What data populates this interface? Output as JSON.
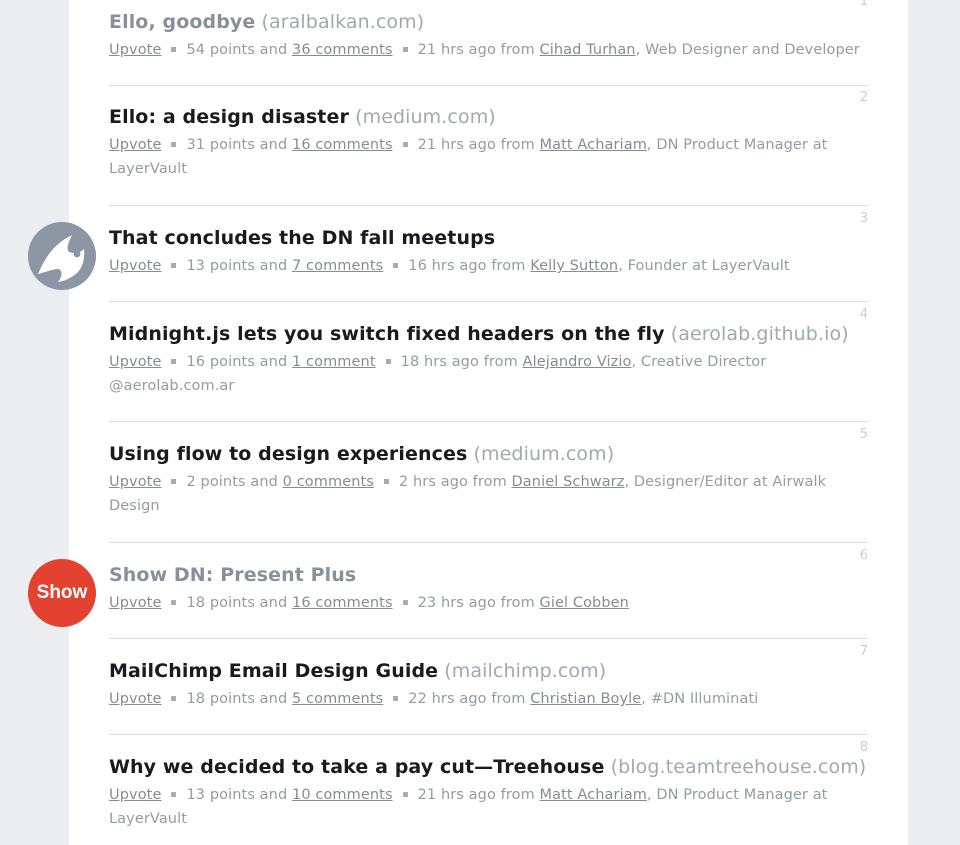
{
  "stories": [
    {
      "rank": "1",
      "title": "Ello, goodbye",
      "domain": "(aralbalkan.com)",
      "title_muted": true,
      "upvote": "Upvote",
      "points": "54 points and",
      "comments": "36 comments",
      "time": "21 hrs ago from",
      "author": "Cihad Turhan",
      "author_title": ", Web Designer and Developer"
    },
    {
      "rank": "2",
      "title": "Ello: a design disaster",
      "domain": "(medium.com)",
      "title_muted": false,
      "upvote": "Upvote",
      "points": "31 points and",
      "comments": "16 comments",
      "time": "21 hrs ago from",
      "author": "Matt Achariam",
      "author_title": ", DN Product Manager at LayerVault"
    },
    {
      "rank": "3",
      "title": "That concludes the DN fall meetups",
      "domain": "",
      "title_muted": false,
      "upvote": "Upvote",
      "points": "13 points and",
      "comments": "7 comments",
      "time": "16 hrs ago from",
      "author": "Kelly Sutton",
      "author_title": ", Founder at LayerVault"
    },
    {
      "rank": "4",
      "title": "Midnight.js lets you switch fixed headers on the fly",
      "domain": "(aerolab.github.io)",
      "title_muted": false,
      "upvote": "Upvote",
      "points": "16 points and",
      "comments": "1 comment",
      "time": "18 hrs ago from",
      "author": "Alejandro Vizio",
      "author_title": ", Creative Director @aerolab.com.ar"
    },
    {
      "rank": "5",
      "title": "Using flow to design experiences",
      "domain": "(medium.com)",
      "title_muted": false,
      "upvote": "Upvote",
      "points": "2 points and",
      "comments": "0 comments",
      "time": "2 hrs ago from",
      "author": "Daniel Schwarz",
      "author_title": ", Designer/Editor at Airwalk Design"
    },
    {
      "rank": "6",
      "title": "Show DN: Present Plus",
      "domain": "",
      "title_muted": true,
      "upvote": "Upvote",
      "points": "18 points and",
      "comments": "16 comments",
      "time": "23 hrs ago from",
      "author": "Giel Cobben",
      "author_title": ""
    },
    {
      "rank": "7",
      "title": "MailChimp Email Design Guide",
      "domain": "(mailchimp.com)",
      "title_muted": false,
      "upvote": "Upvote",
      "points": "18 points and",
      "comments": "5 comments",
      "time": "22 hrs ago from",
      "author": "Christian Boyle",
      "author_title": ", #DN Illuminati"
    },
    {
      "rank": "8",
      "title": "Why we decided to take a pay cut—Treehouse",
      "domain": "(blog.teamtreehouse.com)",
      "title_muted": false,
      "upvote": "Upvote",
      "points": "13 points and",
      "comments": "10 comments",
      "time": "21 hrs ago from",
      "author": "Matt Achariam",
      "author_title": ", DN Product Manager at LayerVault"
    }
  ],
  "badges": {
    "show_label": "Show",
    "logo_icon": "dn-logo-icon"
  },
  "colors": {
    "show_badge": "#e2422f",
    "logo_badge": "#8c96a4",
    "background": "#ebedf1"
  }
}
